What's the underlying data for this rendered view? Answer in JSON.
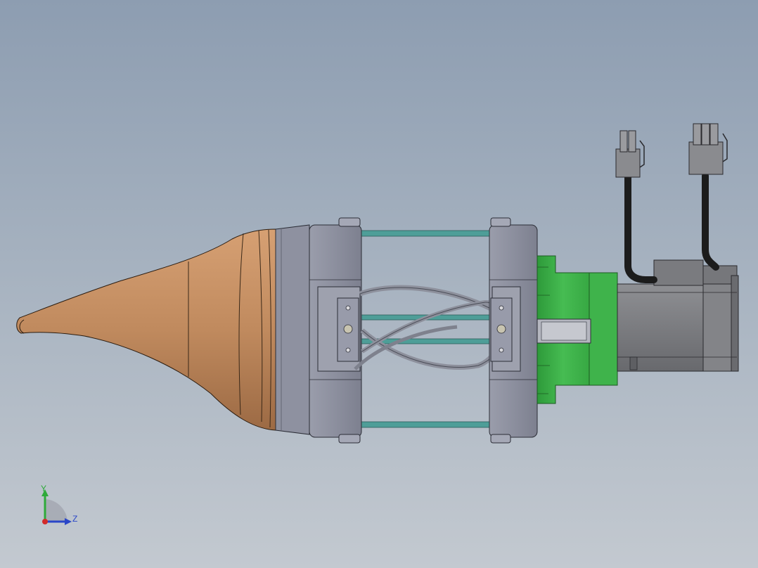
{
  "view": {
    "model": "cad-assembly",
    "colors": {
      "bg_top": "#8d9db1",
      "bg_bottom": "#c3c9d0",
      "tip": "#c08a5e",
      "tip_dark": "#8e5f3c",
      "housing": "#8c8f9e",
      "housing_light": "#a5a8b6",
      "rod": "#4e9e98",
      "motor_flange": "#3fb34b",
      "motor_body": "#7b7c80",
      "cable": "#1c1c1c",
      "connector": "#8a8b8f"
    }
  },
  "triad": {
    "y_label": "Y",
    "z_label": "Z",
    "x_color": "#d22a2a",
    "y_color": "#2eaa3a",
    "z_color": "#2a46c8"
  }
}
